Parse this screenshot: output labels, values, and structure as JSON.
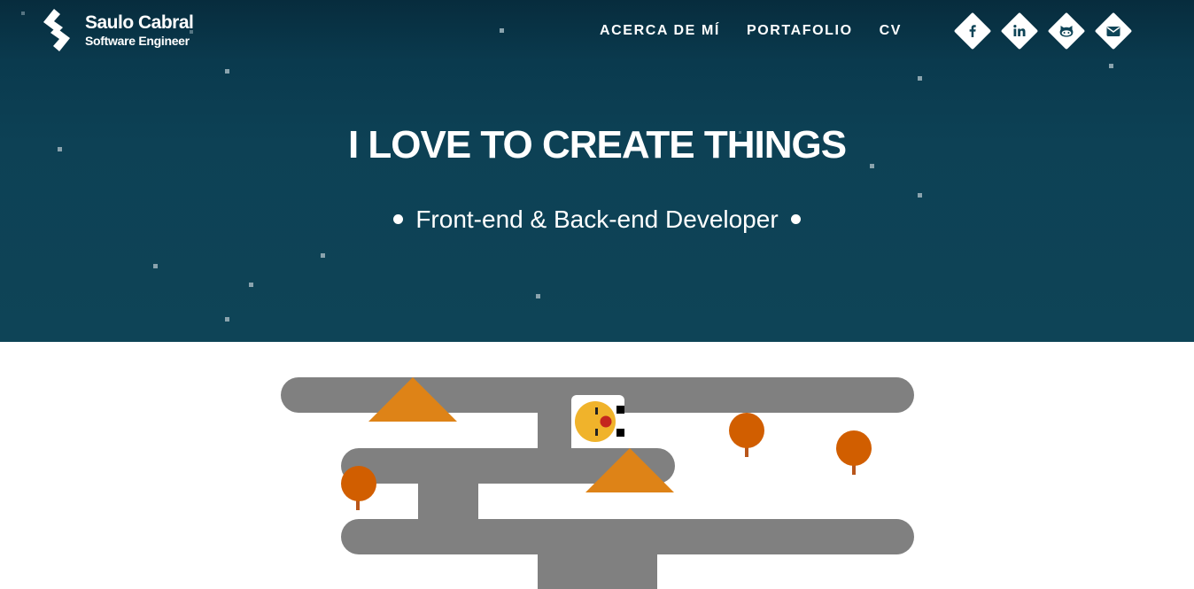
{
  "brand": {
    "name": "Saulo Cabral",
    "role": "Software Engineer",
    "logo_icon": "s-chevron-logo-icon"
  },
  "nav": {
    "items": [
      {
        "label": "ACERCA DE MÍ"
      },
      {
        "label": "PORTAFOLIO"
      },
      {
        "label": "CV"
      }
    ]
  },
  "social": [
    {
      "icon": "facebook-icon"
    },
    {
      "icon": "linkedin-icon"
    },
    {
      "icon": "github-icon"
    },
    {
      "icon": "envelope-icon"
    }
  ],
  "hero": {
    "headline": "I LOVE TO CREATE THINGS",
    "tagline": "Front-end & Back-end Developer"
  },
  "colors": {
    "hero_top": "#072c3d",
    "hero_bottom": "#0e4457",
    "star": "#8aa3ad",
    "road": "#808080",
    "tent": "#de8317",
    "tree": "#d15e00",
    "trunk": "#b8561b",
    "character": "#f0b32b"
  }
}
